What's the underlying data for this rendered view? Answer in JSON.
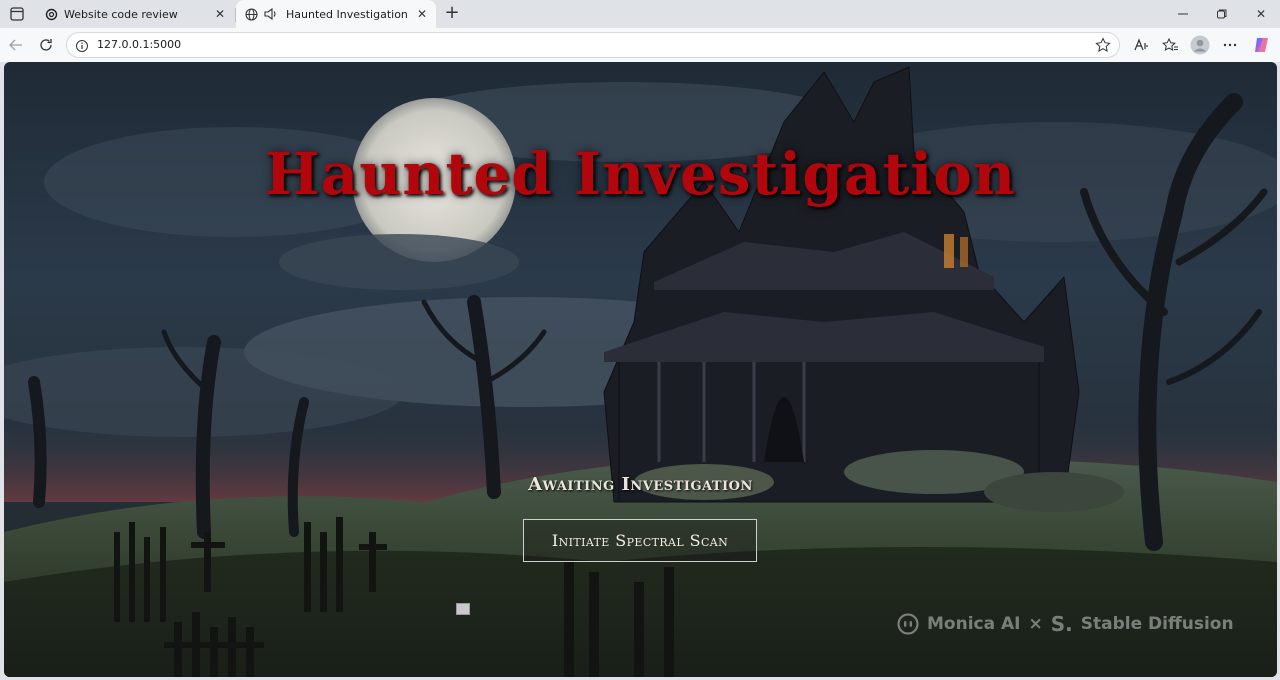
{
  "browser": {
    "tabs": [
      {
        "title": "Website code review",
        "active": false
      },
      {
        "title": "Haunted Investigation",
        "active": true
      }
    ],
    "address": {
      "url": "127.0.0.1:5000"
    },
    "colors": {
      "chrome_bg": "#dfe3e8",
      "active_tab_bg": "#f7f8fa"
    }
  },
  "page": {
    "title": "Haunted Investigation",
    "status": "Awaiting Investigation",
    "scan_button_label": "Initiate Spectral Scan",
    "watermark": {
      "brand_a": "Monica AI",
      "separator": "×",
      "brand_b": "Stable Diffusion",
      "s_mark": "S."
    },
    "colors": {
      "title": "#b0060c",
      "text": "#ece6da"
    }
  },
  "icons": {
    "tab_actions": "tab-actions-icon",
    "chatgpt": "chatgpt-favicon-icon",
    "globe": "globe-icon",
    "speaker": "speaker-icon",
    "close": "close-icon",
    "new_tab": "plus-icon",
    "minimize": "minimize-icon",
    "maximize": "maximize-icon",
    "window_close": "window-close-icon",
    "back": "back-arrow-icon",
    "reload": "reload-icon",
    "info": "info-icon",
    "favorite": "star-icon",
    "read_aloud": "read-aloud-icon",
    "favorites": "favorites-icon",
    "profile": "profile-avatar-icon",
    "more": "more-icon",
    "copilot": "copilot-icon"
  }
}
